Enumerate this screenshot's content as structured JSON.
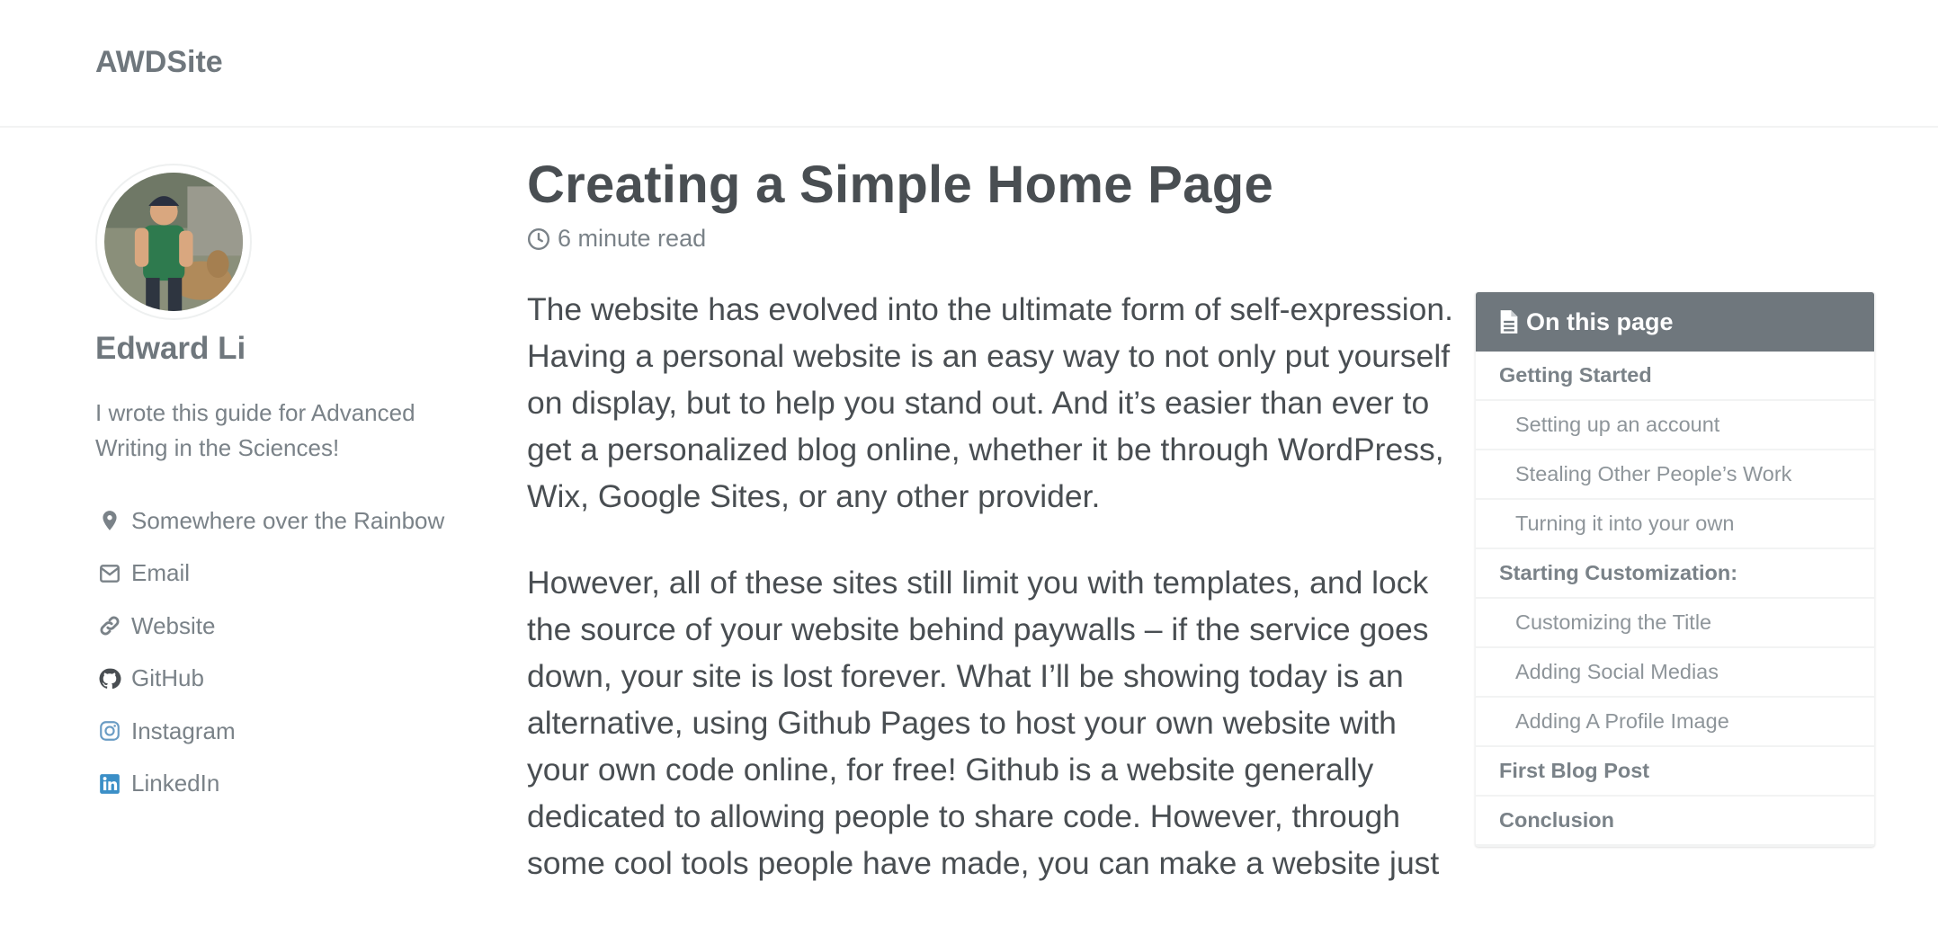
{
  "site": {
    "title": "AWDSite"
  },
  "author": {
    "name": "Edward Li",
    "bio": "I wrote this guide for Advanced Writing in the Sciences!",
    "links": [
      {
        "icon": "map-marker-icon",
        "label": "Somewhere over the Rainbow"
      },
      {
        "icon": "envelope-icon",
        "label": "Email"
      },
      {
        "icon": "link-icon",
        "label": "Website"
      },
      {
        "icon": "github-icon",
        "label": "GitHub"
      },
      {
        "icon": "instagram-icon",
        "label": "Instagram"
      },
      {
        "icon": "linkedin-icon",
        "label": "LinkedIn"
      }
    ]
  },
  "post": {
    "title": "Creating a Simple Home Page",
    "read_time": "6 minute read",
    "paragraphs": [
      "The website has evolved into the ultimate form of self-expression. Having a personal website is an easy way to not only put yourself on display, but to help you stand out. And it’s easier than ever to get a personalized blog online, whether it be through WordPress, Wix, Google Sites, or any other provider.",
      "However, all of these sites still limit you with templates, and lock the source of your website behind paywalls – if the service goes down, your site is lost forever. What I’ll be showing today is an alternative, using Github Pages to host your own website with your own code online, for free! Github is a website generally dedicated to allowing people to share code. However, through some cool tools people have made, you can make a website just"
    ]
  },
  "toc": {
    "header": "On this page",
    "items": [
      {
        "label": "Getting Started",
        "level": 1
      },
      {
        "label": "Setting up an account",
        "level": 2
      },
      {
        "label": "Stealing Other People’s Work",
        "level": 2
      },
      {
        "label": "Turning it into your own",
        "level": 2
      },
      {
        "label": "Starting Customization:",
        "level": 1
      },
      {
        "label": "Customizing the Title",
        "level": 2
      },
      {
        "label": "Adding Social Medias",
        "level": 2
      },
      {
        "label": "Adding A Profile Image",
        "level": 2
      },
      {
        "label": "First Blog Post",
        "level": 1
      },
      {
        "label": "Conclusion",
        "level": 1
      }
    ]
  },
  "colors": {
    "text": "#494e52",
    "muted": "#7a8288",
    "toc_header_bg": "#6f777d",
    "linkedin": "#3b8fc7",
    "instagram": "#6a9cc4"
  }
}
